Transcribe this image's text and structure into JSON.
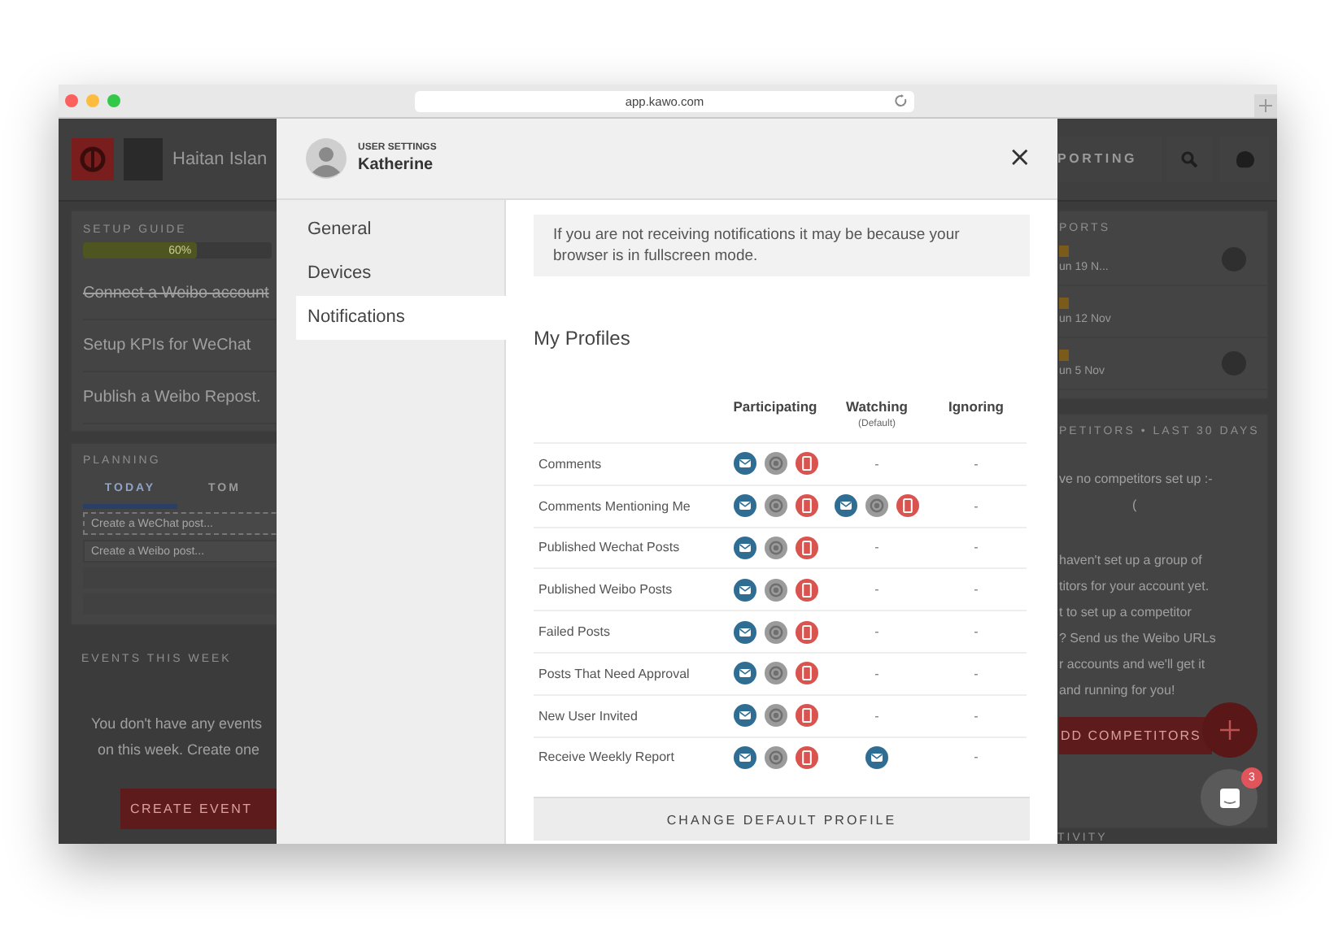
{
  "browser": {
    "url": "app.kawo.com"
  },
  "app": {
    "header": {
      "workspace": "Haitan Islan",
      "nav_item": "PORTING"
    },
    "setup_guide": {
      "label": "SETUP GUIDE",
      "progress": {
        "level": 0.6,
        "reading": "60%"
      },
      "tasks": [
        {
          "label": "Connect a Weibo account",
          "done": true
        },
        {
          "label": "Setup KPIs for WeChat",
          "done": false
        },
        {
          "label": "Publish a Weibo Repost.",
          "done": false
        }
      ]
    },
    "planning": {
      "label": "PLANNING",
      "tabs": [
        {
          "label": "TODAY",
          "selected": true
        },
        {
          "label": "TOM",
          "selected": false
        }
      ],
      "placeholders": [
        "Create a WeChat post...",
        "Create a Weibo post..."
      ]
    },
    "events": {
      "label": "EVENTS THIS WEEK",
      "message": [
        "You don't have any events",
        "on this week. Create one"
      ],
      "button": "CREATE EVENT"
    },
    "reports": {
      "label": "PORTS",
      "items": [
        {
          "date": "un 19 N...",
          "has_avatar": true
        },
        {
          "date": "un 12 Nov",
          "has_avatar": false
        },
        {
          "date": "un 5 Nov",
          "has_avatar": true
        }
      ]
    },
    "competitors": {
      "label": "PETITORS • LAST 30 DAYS",
      "paragraphs": [
        [
          "ve no competitors set up :-",
          "("
        ],
        [
          "haven't set up a group of",
          "titors for your account yet.",
          "t to set up a competitor",
          "? Send us the Weibo URLs",
          "r accounts and we'll get it",
          "and running for you!"
        ]
      ],
      "button": "DD COMPETITORS"
    },
    "activity": {
      "label": "TIVITY"
    },
    "chat": {
      "badge": "3"
    }
  },
  "modal": {
    "eyebrow": "USER SETTINGS",
    "user": "Katherine",
    "close": "×",
    "nav": [
      {
        "label": "General",
        "selected": false
      },
      {
        "label": "Devices",
        "selected": false
      },
      {
        "label": "Notifications",
        "selected": true
      }
    ],
    "notice": "If you are not receiving notifications it may be because your browser is in fullscreen mode.",
    "heading": "My Profiles",
    "columns": [
      {
        "label": "Participating"
      },
      {
        "label": "Watching",
        "note": "(Default)"
      },
      {
        "label": "Ignoring"
      }
    ],
    "rows": [
      {
        "label": "Comments",
        "cells": [
          {
            "icons": [
              {
                "kind": "email"
              },
              {
                "kind": "browser"
              },
              {
                "kind": "mobile"
              }
            ]
          },
          {
            "text": "-"
          },
          {
            "text": "-"
          }
        ]
      },
      {
        "label": "Comments Mentioning Me",
        "cells": [
          {
            "icons": [
              {
                "kind": "email"
              },
              {
                "kind": "browser"
              },
              {
                "kind": "mobile"
              }
            ]
          },
          {
            "icons": [
              {
                "kind": "email"
              },
              {
                "kind": "browser"
              },
              {
                "kind": "mobile"
              }
            ]
          },
          {
            "text": "-"
          }
        ]
      },
      {
        "label": "Published Wechat Posts",
        "cells": [
          {
            "icons": [
              {
                "kind": "email"
              },
              {
                "kind": "browser"
              },
              {
                "kind": "mobile"
              }
            ]
          },
          {
            "text": "-"
          },
          {
            "text": "-"
          }
        ]
      },
      {
        "label": "Published Weibo Posts",
        "cells": [
          {
            "icons": [
              {
                "kind": "email"
              },
              {
                "kind": "browser"
              },
              {
                "kind": "mobile"
              }
            ]
          },
          {
            "text": "-"
          },
          {
            "text": "-"
          }
        ]
      },
      {
        "label": "Failed Posts",
        "cells": [
          {
            "icons": [
              {
                "kind": "email"
              },
              {
                "kind": "browser"
              },
              {
                "kind": "mobile"
              }
            ]
          },
          {
            "text": "-"
          },
          {
            "text": "-"
          }
        ]
      },
      {
        "label": "Posts That Need Approval",
        "cells": [
          {
            "icons": [
              {
                "kind": "email"
              },
              {
                "kind": "browser"
              },
              {
                "kind": "mobile"
              }
            ]
          },
          {
            "text": "-"
          },
          {
            "text": "-"
          }
        ]
      },
      {
        "label": "New User Invited",
        "cells": [
          {
            "icons": [
              {
                "kind": "email"
              },
              {
                "kind": "browser"
              },
              {
                "kind": "mobile"
              }
            ]
          },
          {
            "text": "-"
          },
          {
            "text": "-"
          }
        ]
      },
      {
        "label": "Receive Weekly Report",
        "cells": [
          {
            "icons": [
              {
                "kind": "email"
              },
              {
                "kind": "browser"
              },
              {
                "kind": "mobile"
              }
            ]
          },
          {
            "icons": [
              {
                "kind": "email"
              }
            ]
          },
          {
            "text": "-"
          }
        ]
      }
    ],
    "button": "CHANGE DEFAULT PROFILE"
  }
}
